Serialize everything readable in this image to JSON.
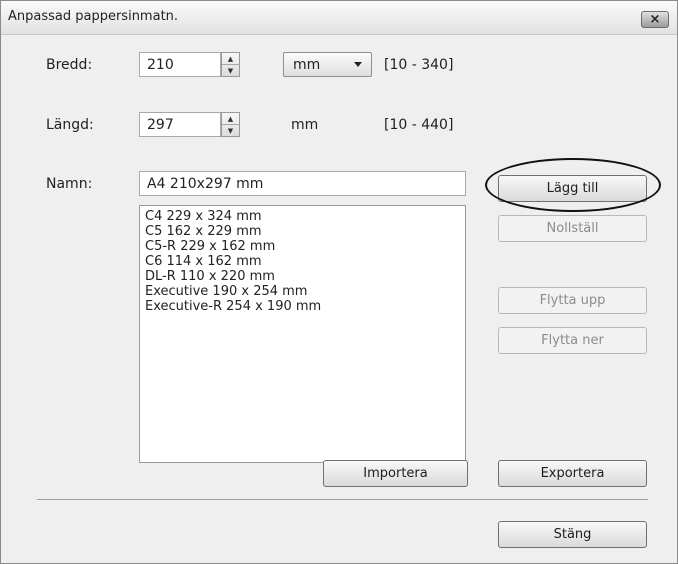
{
  "window": {
    "title": "Anpassad pappersinmatn.",
    "close_icon": "×"
  },
  "width": {
    "label": "Bredd:",
    "value": "210",
    "unit": "mm",
    "range": "[10 - 340]"
  },
  "length": {
    "label": "Längd:",
    "value": "297",
    "unit": "mm",
    "range": "[10 - 440]"
  },
  "name": {
    "label": "Namn:",
    "value": "A4 210x297 mm"
  },
  "paper_list": [
    "C4 229 x 324 mm",
    "C5 162 x 229 mm",
    "C5-R 229 x 162 mm",
    "C6 114 x 162 mm",
    "DL-R 110 x 220 mm",
    "Executive 190 x 254 mm",
    "Executive-R 254 x 190 mm"
  ],
  "buttons": {
    "add": "Lägg till",
    "reset": "Nollställ",
    "move_up": "Flytta upp",
    "move_down": "Flytta ner",
    "import": "Importera",
    "export": "Exportera",
    "close": "Stäng"
  }
}
